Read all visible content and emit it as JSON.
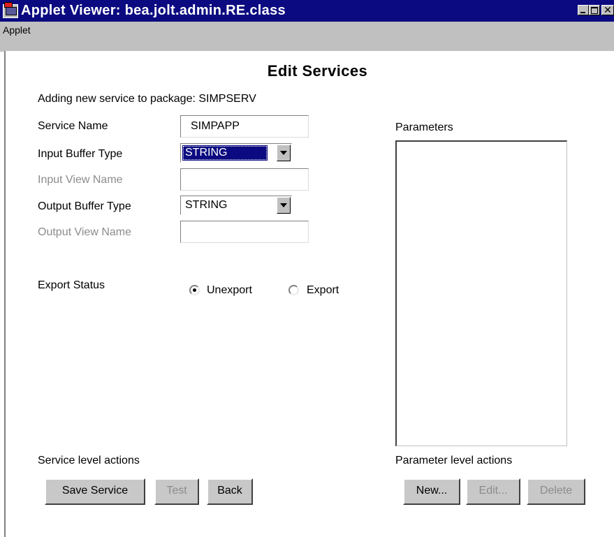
{
  "window": {
    "title": "Applet Viewer: bea.jolt.admin.RE.class",
    "close_glyph": "✕"
  },
  "menu": {
    "items": [
      "Applet"
    ]
  },
  "heading": "Edit Services",
  "info_text": "Adding new service to package: SIMPSERV",
  "form": {
    "service_name": {
      "label": "Service Name",
      "value": "SIMPAPP"
    },
    "input_buffer_type": {
      "label": "Input Buffer Type",
      "value": "STRING"
    },
    "input_view_name": {
      "label": "Input View Name",
      "value": ""
    },
    "output_buffer_type": {
      "label": "Output Buffer Type",
      "value": "STRING"
    },
    "output_view_name": {
      "label": "Output View Name",
      "value": ""
    }
  },
  "export_status": {
    "label": "Export Status",
    "options": [
      {
        "label": "Unexport",
        "selected": true
      },
      {
        "label": "Export",
        "selected": false
      }
    ]
  },
  "parameters": {
    "label": "Parameters",
    "items": []
  },
  "service_actions": {
    "label": "Service level actions",
    "buttons": [
      {
        "label": "Save Service",
        "enabled": true
      },
      {
        "label": "Test",
        "enabled": false
      },
      {
        "label": "Back",
        "enabled": true
      }
    ]
  },
  "parameter_actions": {
    "label": "Parameter level actions",
    "buttons": [
      {
        "label": "New...",
        "enabled": true
      },
      {
        "label": "Edit...",
        "enabled": false
      },
      {
        "label": "Delete",
        "enabled": false
      }
    ]
  },
  "colors": {
    "titlebar": "#0b0a80",
    "chrome": "#c0c0c0",
    "disabled_text": "#8c8c8c",
    "selection": "#0b0a80"
  }
}
